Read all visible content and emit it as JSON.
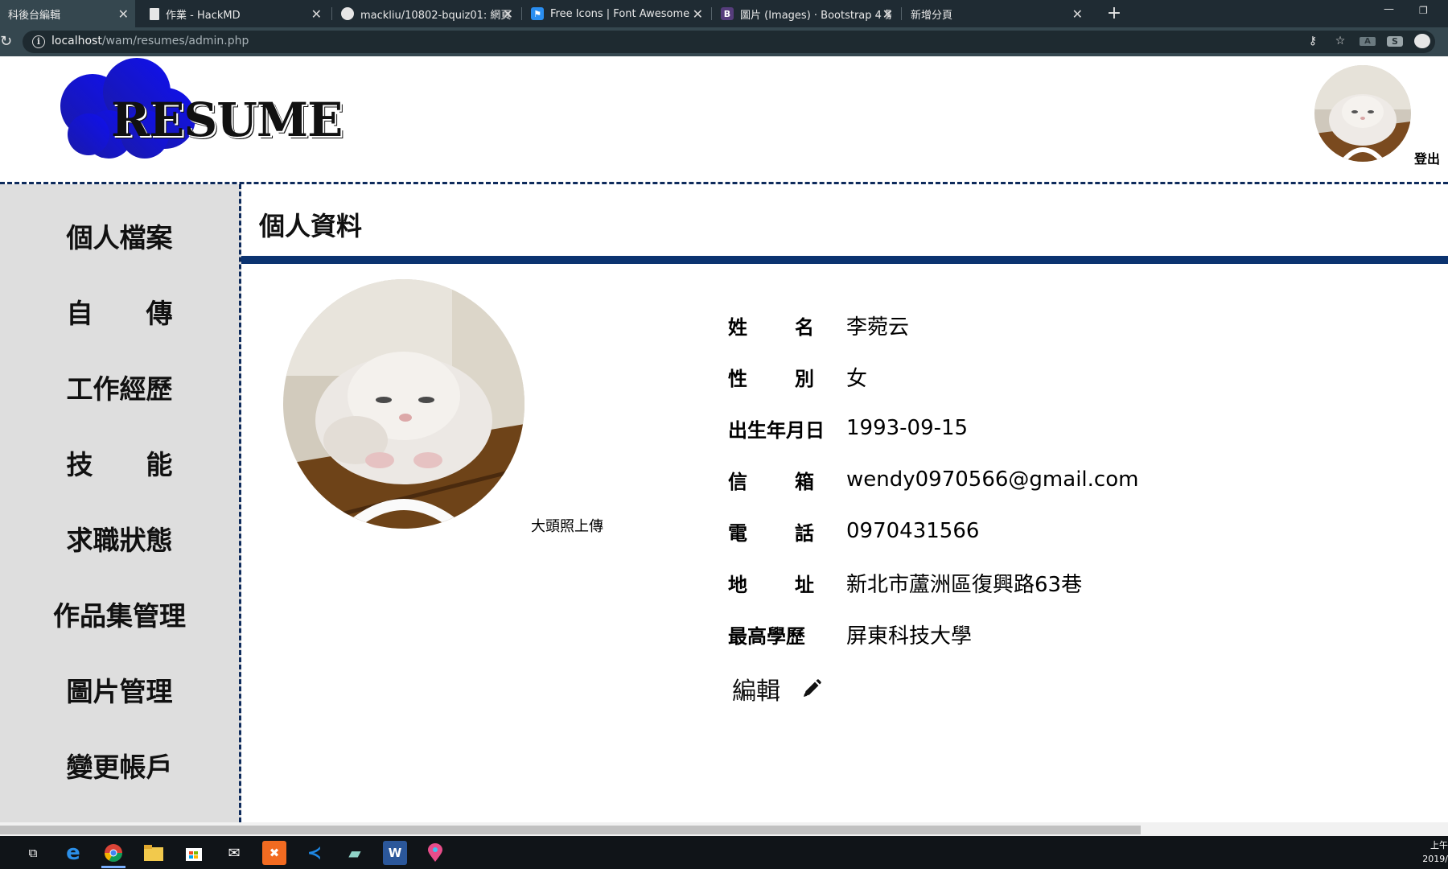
{
  "browser": {
    "tabs": [
      {
        "title": "科後台編輯",
        "favicon": "page-icon",
        "active": true
      },
      {
        "title": "作業 - HackMD",
        "favicon": "doc-icon",
        "active": false
      },
      {
        "title": "mackliu/10802-bquiz01: 網頁乙",
        "favicon": "github-icon",
        "active": false
      },
      {
        "title": "Free Icons | Font Awesome",
        "favicon": "flag-icon",
        "active": false
      },
      {
        "title": "圖片 (Images) · Bootstrap 4 繁體",
        "favicon": "bootstrap-icon",
        "active": false
      },
      {
        "title": "新增分頁",
        "favicon": "",
        "active": false
      }
    ],
    "favicon_letters": {
      "bootstrap": "B"
    },
    "url_host": "localhost",
    "url_path": "/wam/resumes/admin.php"
  },
  "header": {
    "logo_text": "RESUME",
    "logo_blob_color": "#1414d6",
    "logout_label": "登出"
  },
  "sidebar": {
    "items": [
      {
        "label": "個人檔案"
      },
      {
        "label": "自　　傳"
      },
      {
        "label": "工作經歷"
      },
      {
        "label": "技　　能"
      },
      {
        "label": "求職狀態"
      },
      {
        "label": "作品集管理"
      },
      {
        "label": "圖片管理"
      },
      {
        "label": "變更帳戶"
      }
    ]
  },
  "main": {
    "section_title": "個人資料",
    "photo_upload_label": "大頭照上傳",
    "fields": [
      {
        "label_chars": [
          "姓",
          "名"
        ],
        "value": "李菀云"
      },
      {
        "label_chars": [
          "性",
          "別"
        ],
        "value": "女"
      },
      {
        "label_chars": [
          "出生年月日"
        ],
        "value": "1993-09-15"
      },
      {
        "label_chars": [
          "信",
          "箱"
        ],
        "value": "wendy0970566@gmail.com"
      },
      {
        "label_chars": [
          "電",
          "話"
        ],
        "value": "0970431566"
      },
      {
        "label_chars": [
          "地",
          "址"
        ],
        "value": "新北市蘆洲區復興路63巷"
      },
      {
        "label_chars": [
          "最高學歷"
        ],
        "value": "屏東科技大學"
      }
    ],
    "edit_label": "編輯"
  },
  "colors": {
    "accent_navy": "#0b3370",
    "sidebar_bg": "#dedede"
  },
  "taskbar": {
    "clock_line1": "上午",
    "clock_line2": "2019/"
  }
}
